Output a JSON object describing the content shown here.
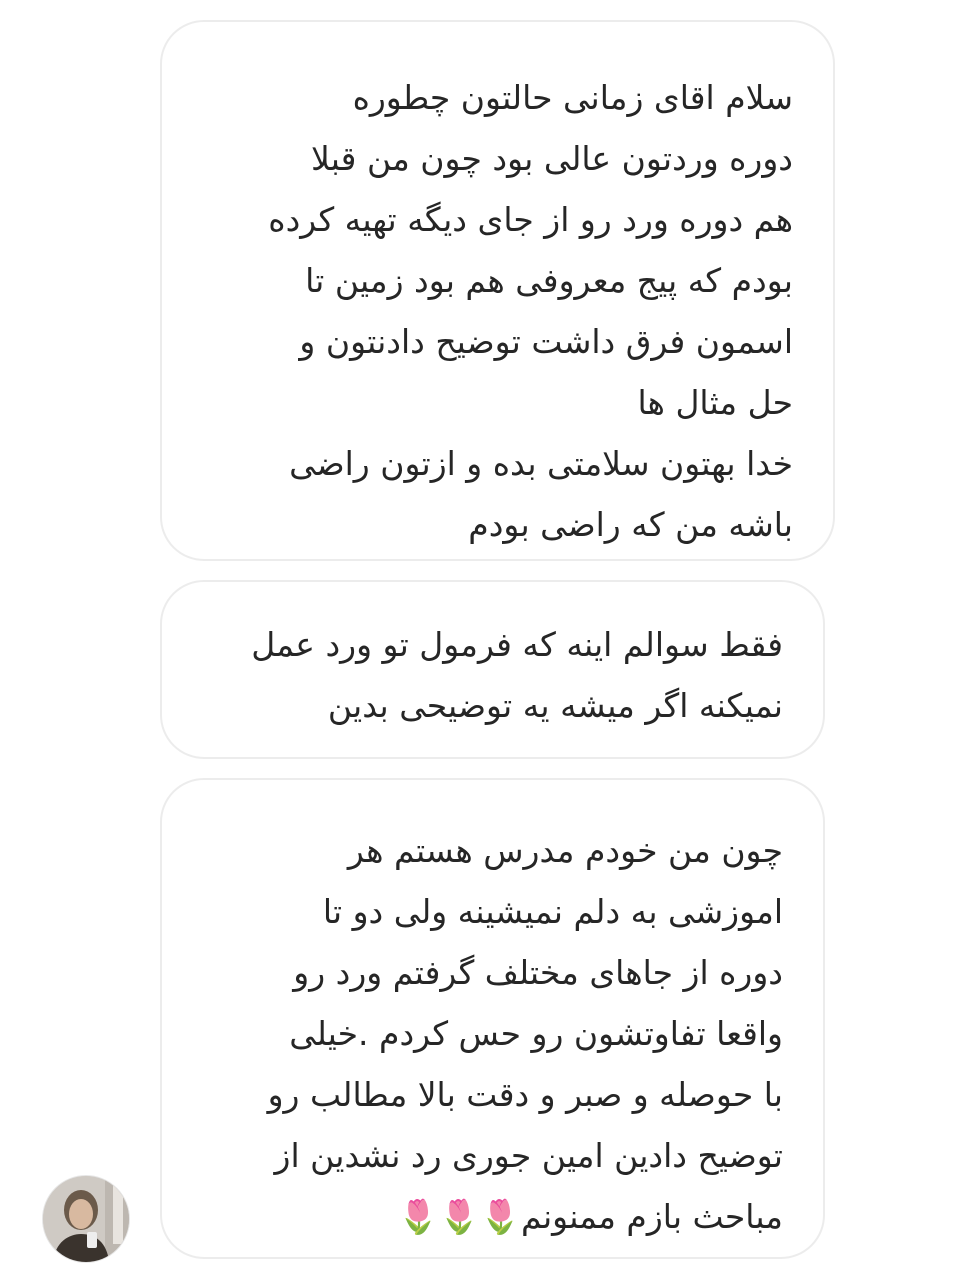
{
  "messages": [
    {
      "lines": [
        "سلام اقای زمانی حالتون چطوره",
        "دوره وردتون عالی بود چون من قبلا",
        "هم دوره ورد رو از جای دیگه تهیه کرده",
        "بودم که پیج معروفی هم بود  زمین تا",
        "اسمون فرق داشت توضیح دادنتون و",
        "حل مثال ها",
        "خدا بهتون سلامتی بده و ازتون راضی",
        "باشه من که راضی بودم"
      ]
    },
    {
      "lines": [
        "فقط سوالم اینه که فرمول تو ورد عمل",
        "نمیکنه اگر میشه یه توضیحی بدین"
      ]
    },
    {
      "lines": [
        "چون من خودم مدرس هستم هر",
        "اموزشی به دلم نمیشینه ولی دو تا",
        "دوره از جاهای مختلف گرفتم ورد رو",
        "واقعا تفاوتشون رو حس کردم .خیلی",
        "با حوصله و صبر و دقت بالا مطالب رو",
        "توضیح دادین امین جوری رد نشدین از",
        "مباحث بازم ممنونم🌷🌷🌷"
      ]
    }
  ],
  "sender": {
    "avatar_icon": "person-avatar"
  }
}
